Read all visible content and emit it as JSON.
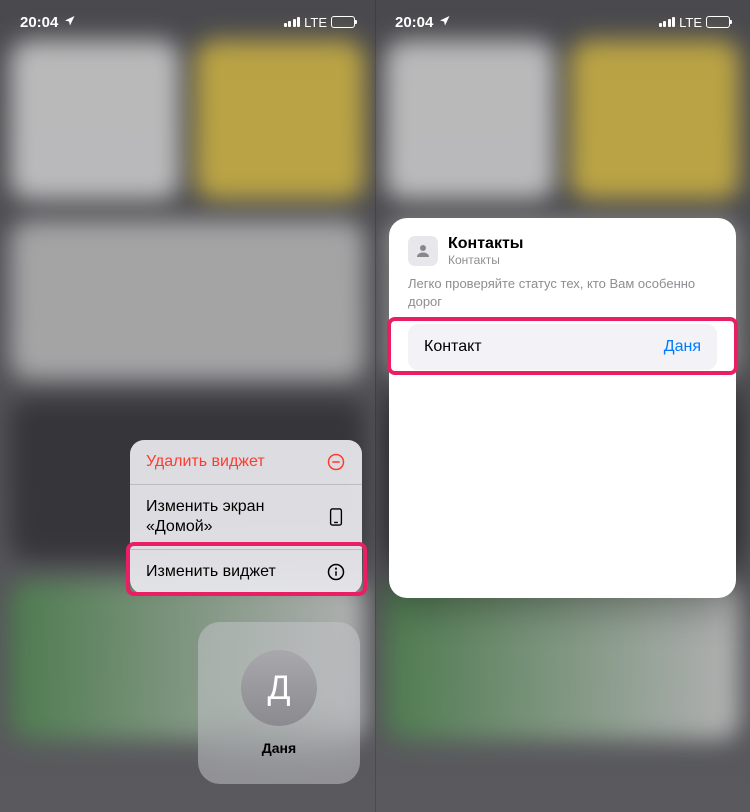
{
  "status": {
    "time": "20:04",
    "network": "LTE"
  },
  "screen1": {
    "menu": {
      "delete": "Удалить виджет",
      "edit_home": "Изменить экран «Домой»",
      "edit_widget": "Изменить виджет"
    },
    "widget": {
      "initial": "Д",
      "name": "Даня"
    }
  },
  "screen2": {
    "sheet": {
      "title": "Контакты",
      "subtitle": "Контакты",
      "description": "Легко проверяйте статус тех, кто Вам особенно дорог",
      "setting_label": "Контакт",
      "setting_value": "Даня"
    }
  },
  "icons": {
    "location": "loc-icon",
    "minus_circle": "minus-circle-icon",
    "phone": "phone-icon",
    "info": "info-circle-icon",
    "contacts": "contacts-app-icon"
  }
}
